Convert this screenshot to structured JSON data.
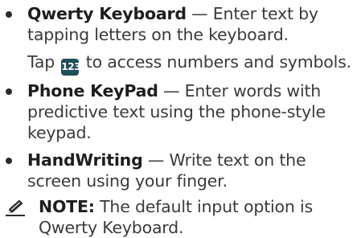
{
  "bullets": [
    {
      "term": "Qwerty Keyboard",
      "description": " — Enter text by tapping letters on the keyboard."
    },
    {
      "term": "Phone KeyPad",
      "description": " — Enter words with predictive text using the phone-style keypad."
    },
    {
      "term": "HandWriting",
      "description": " — Write text on the screen using your finger."
    }
  ],
  "tap_hint": {
    "before": "Tap ",
    "key_label": "123",
    "after": " to access numbers and symbols."
  },
  "note": {
    "label": "NOTE:",
    "text": " The default input option is Qwerty Keyboard."
  },
  "icons": {
    "bullet": "bullet-dot-icon",
    "key": "numbers-key-icon",
    "note": "pencil-note-icon"
  },
  "colors": {
    "key_badge": "#1f4e5c",
    "text": "#3a3a3a"
  }
}
